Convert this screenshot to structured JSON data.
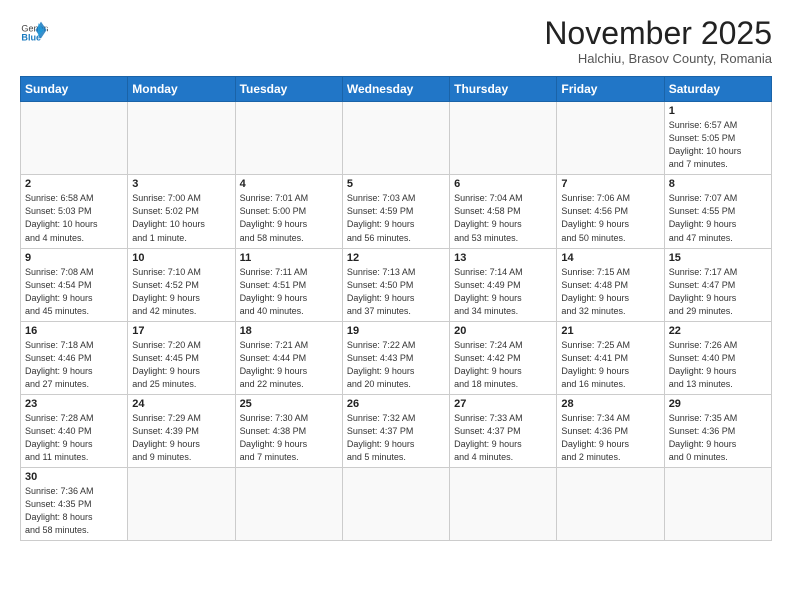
{
  "header": {
    "logo_general": "General",
    "logo_blue": "Blue",
    "month_year": "November 2025",
    "location": "Halchiu, Brasov County, Romania"
  },
  "weekdays": [
    "Sunday",
    "Monday",
    "Tuesday",
    "Wednesday",
    "Thursday",
    "Friday",
    "Saturday"
  ],
  "weeks": [
    [
      {
        "day": "",
        "info": ""
      },
      {
        "day": "",
        "info": ""
      },
      {
        "day": "",
        "info": ""
      },
      {
        "day": "",
        "info": ""
      },
      {
        "day": "",
        "info": ""
      },
      {
        "day": "",
        "info": ""
      },
      {
        "day": "1",
        "info": "Sunrise: 6:57 AM\nSunset: 5:05 PM\nDaylight: 10 hours\nand 7 minutes."
      }
    ],
    [
      {
        "day": "2",
        "info": "Sunrise: 6:58 AM\nSunset: 5:03 PM\nDaylight: 10 hours\nand 4 minutes."
      },
      {
        "day": "3",
        "info": "Sunrise: 7:00 AM\nSunset: 5:02 PM\nDaylight: 10 hours\nand 1 minute."
      },
      {
        "day": "4",
        "info": "Sunrise: 7:01 AM\nSunset: 5:00 PM\nDaylight: 9 hours\nand 58 minutes."
      },
      {
        "day": "5",
        "info": "Sunrise: 7:03 AM\nSunset: 4:59 PM\nDaylight: 9 hours\nand 56 minutes."
      },
      {
        "day": "6",
        "info": "Sunrise: 7:04 AM\nSunset: 4:58 PM\nDaylight: 9 hours\nand 53 minutes."
      },
      {
        "day": "7",
        "info": "Sunrise: 7:06 AM\nSunset: 4:56 PM\nDaylight: 9 hours\nand 50 minutes."
      },
      {
        "day": "8",
        "info": "Sunrise: 7:07 AM\nSunset: 4:55 PM\nDaylight: 9 hours\nand 47 minutes."
      }
    ],
    [
      {
        "day": "9",
        "info": "Sunrise: 7:08 AM\nSunset: 4:54 PM\nDaylight: 9 hours\nand 45 minutes."
      },
      {
        "day": "10",
        "info": "Sunrise: 7:10 AM\nSunset: 4:52 PM\nDaylight: 9 hours\nand 42 minutes."
      },
      {
        "day": "11",
        "info": "Sunrise: 7:11 AM\nSunset: 4:51 PM\nDaylight: 9 hours\nand 40 minutes."
      },
      {
        "day": "12",
        "info": "Sunrise: 7:13 AM\nSunset: 4:50 PM\nDaylight: 9 hours\nand 37 minutes."
      },
      {
        "day": "13",
        "info": "Sunrise: 7:14 AM\nSunset: 4:49 PM\nDaylight: 9 hours\nand 34 minutes."
      },
      {
        "day": "14",
        "info": "Sunrise: 7:15 AM\nSunset: 4:48 PM\nDaylight: 9 hours\nand 32 minutes."
      },
      {
        "day": "15",
        "info": "Sunrise: 7:17 AM\nSunset: 4:47 PM\nDaylight: 9 hours\nand 29 minutes."
      }
    ],
    [
      {
        "day": "16",
        "info": "Sunrise: 7:18 AM\nSunset: 4:46 PM\nDaylight: 9 hours\nand 27 minutes."
      },
      {
        "day": "17",
        "info": "Sunrise: 7:20 AM\nSunset: 4:45 PM\nDaylight: 9 hours\nand 25 minutes."
      },
      {
        "day": "18",
        "info": "Sunrise: 7:21 AM\nSunset: 4:44 PM\nDaylight: 9 hours\nand 22 minutes."
      },
      {
        "day": "19",
        "info": "Sunrise: 7:22 AM\nSunset: 4:43 PM\nDaylight: 9 hours\nand 20 minutes."
      },
      {
        "day": "20",
        "info": "Sunrise: 7:24 AM\nSunset: 4:42 PM\nDaylight: 9 hours\nand 18 minutes."
      },
      {
        "day": "21",
        "info": "Sunrise: 7:25 AM\nSunset: 4:41 PM\nDaylight: 9 hours\nand 16 minutes."
      },
      {
        "day": "22",
        "info": "Sunrise: 7:26 AM\nSunset: 4:40 PM\nDaylight: 9 hours\nand 13 minutes."
      }
    ],
    [
      {
        "day": "23",
        "info": "Sunrise: 7:28 AM\nSunset: 4:40 PM\nDaylight: 9 hours\nand 11 minutes."
      },
      {
        "day": "24",
        "info": "Sunrise: 7:29 AM\nSunset: 4:39 PM\nDaylight: 9 hours\nand 9 minutes."
      },
      {
        "day": "25",
        "info": "Sunrise: 7:30 AM\nSunset: 4:38 PM\nDaylight: 9 hours\nand 7 minutes."
      },
      {
        "day": "26",
        "info": "Sunrise: 7:32 AM\nSunset: 4:37 PM\nDaylight: 9 hours\nand 5 minutes."
      },
      {
        "day": "27",
        "info": "Sunrise: 7:33 AM\nSunset: 4:37 PM\nDaylight: 9 hours\nand 4 minutes."
      },
      {
        "day": "28",
        "info": "Sunrise: 7:34 AM\nSunset: 4:36 PM\nDaylight: 9 hours\nand 2 minutes."
      },
      {
        "day": "29",
        "info": "Sunrise: 7:35 AM\nSunset: 4:36 PM\nDaylight: 9 hours\nand 0 minutes."
      }
    ],
    [
      {
        "day": "30",
        "info": "Sunrise: 7:36 AM\nSunset: 4:35 PM\nDaylight: 8 hours\nand 58 minutes."
      },
      {
        "day": "",
        "info": ""
      },
      {
        "day": "",
        "info": ""
      },
      {
        "day": "",
        "info": ""
      },
      {
        "day": "",
        "info": ""
      },
      {
        "day": "",
        "info": ""
      },
      {
        "day": "",
        "info": ""
      }
    ]
  ]
}
